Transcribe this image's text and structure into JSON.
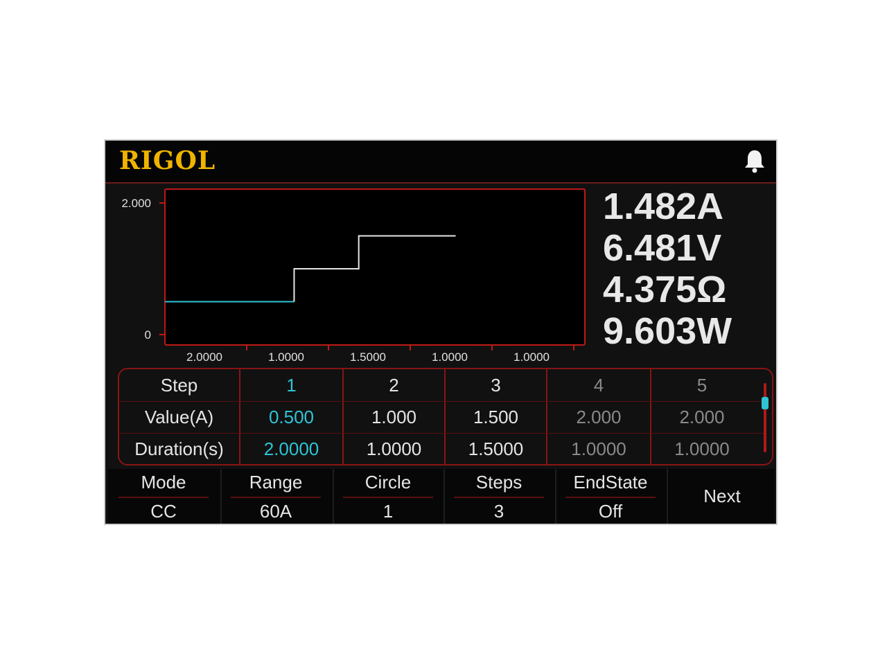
{
  "header": {
    "logo": "RIGOL",
    "icons": [
      "bell-icon"
    ]
  },
  "chart_data": {
    "type": "line",
    "ylim": [
      0,
      2.0
    ],
    "y_tick_labels": [
      "2.000",
      "0"
    ],
    "x_tick_labels": [
      "2.0000",
      "1.0000",
      "1.5000",
      "1.0000",
      "1.0000"
    ],
    "series": [
      {
        "values": [
          0.5,
          0.5,
          1.0,
          1.0,
          1.5,
          1.5
        ],
        "x": [
          0,
          2.0,
          2.0,
          3.0,
          3.0,
          4.5
        ]
      }
    ],
    "xlim": [
      0,
      6.5
    ]
  },
  "readings": {
    "current": "1.482A",
    "voltage": "6.481V",
    "resistance": "4.375Ω",
    "power": "9.603W"
  },
  "table": {
    "headers": {
      "step": "Step",
      "value": "Value(A)",
      "duration": "Duration(s)"
    },
    "steps": [
      "1",
      "2",
      "3",
      "4",
      "5"
    ],
    "values": [
      "0.500",
      "1.000",
      "1.500",
      "2.000",
      "2.000"
    ],
    "durations": [
      "2.0000",
      "1.0000",
      "1.5000",
      "1.0000",
      "1.0000"
    ]
  },
  "softkeys": {
    "mode": {
      "label": "Mode",
      "value": "CC"
    },
    "range": {
      "label": "Range",
      "value": "60A"
    },
    "circle": {
      "label": "Circle",
      "value": "1"
    },
    "steps": {
      "label": "Steps",
      "value": "3"
    },
    "endstate": {
      "label": "EndState",
      "value": "Off"
    },
    "next": {
      "label": "Next"
    }
  },
  "colors": {
    "accent": "#2ec4d6",
    "brand": "#f0b400",
    "frame": "#b01818",
    "trace": "#e6e6e6"
  }
}
